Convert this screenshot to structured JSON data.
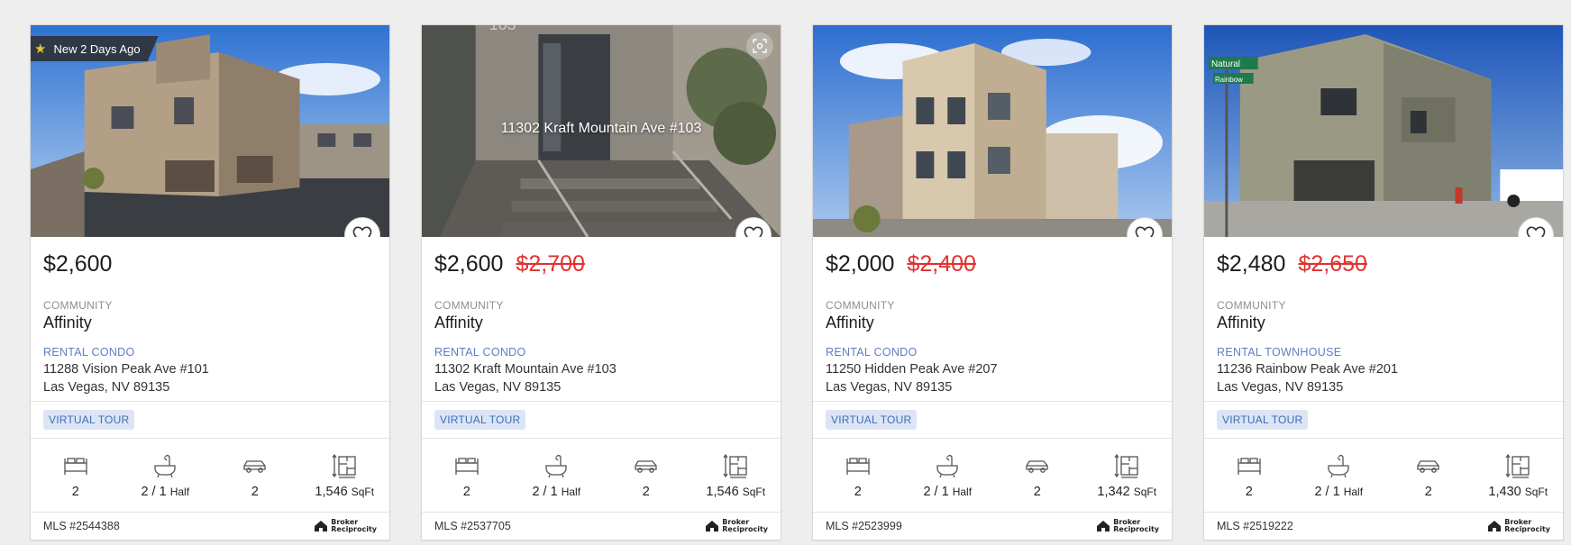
{
  "cards": [
    {
      "badge": "New 2 Days Ago",
      "photo_caption": "",
      "price": "$2,600",
      "old_price": "",
      "community_label": "COMMUNITY",
      "community": "Affinity",
      "property_type": "RENTAL CONDO",
      "address_line1": "11288 Vision Peak Ave #101",
      "address_line2": "Las Vegas, NV 89135",
      "virtual_tour": "VIRTUAL TOUR",
      "beds": "2",
      "baths": "2 / 1",
      "baths_unit": "Half",
      "garage": "2",
      "sqft": "1,546",
      "sqft_unit": "SqFt",
      "mls": "MLS #2544388"
    },
    {
      "badge": "",
      "photo_caption": "11302 Kraft Mountain Ave #103",
      "price": "$2,600",
      "old_price": "$2,700",
      "community_label": "COMMUNITY",
      "community": "Affinity",
      "property_type": "RENTAL CONDO",
      "address_line1": "11302 Kraft Mountain Ave #103",
      "address_line2": "Las Vegas, NV 89135",
      "virtual_tour": "VIRTUAL TOUR",
      "beds": "2",
      "baths": "2 / 1",
      "baths_unit": "Half",
      "garage": "2",
      "sqft": "1,546",
      "sqft_unit": "SqFt",
      "mls": "MLS #2537705"
    },
    {
      "badge": "",
      "photo_caption": "",
      "price": "$2,000",
      "old_price": "$2,400",
      "community_label": "COMMUNITY",
      "community": "Affinity",
      "property_type": "RENTAL CONDO",
      "address_line1": "11250 Hidden Peak Ave #207",
      "address_line2": "Las Vegas, NV 89135",
      "virtual_tour": "VIRTUAL TOUR",
      "beds": "2",
      "baths": "2 / 1",
      "baths_unit": "Half",
      "garage": "2",
      "sqft": "1,342",
      "sqft_unit": "SqFt",
      "mls": "MLS #2523999"
    },
    {
      "badge": "",
      "photo_caption": "",
      "price": "$2,480",
      "old_price": "$2,650",
      "community_label": "COMMUNITY",
      "community": "Affinity",
      "property_type": "RENTAL TOWNHOUSE",
      "address_line1": "11236 Rainbow Peak Ave #201",
      "address_line2": "Las Vegas, NV 89135",
      "virtual_tour": "VIRTUAL TOUR",
      "beds": "2",
      "baths": "2 / 1",
      "baths_unit": "Half",
      "garage": "2",
      "sqft": "1,430",
      "sqft_unit": "SqFt",
      "mls": "MLS #2519222"
    }
  ],
  "broker_logo": {
    "line1": "Broker",
    "line2": "Reciprocity"
  },
  "street_sign": {
    "line1": "Natural",
    "line2": "Rainbow"
  },
  "photo_ghost_text": "103",
  "icons": {
    "badge": "star-icon",
    "favorite": "heart-icon",
    "scan": "scan-icon",
    "beds": "bed-icon",
    "baths": "bathtub-icon",
    "garage": "car-icon",
    "sqft": "floorplan-icon",
    "broker": "house-logo-icon"
  },
  "colors": {
    "old_price": "#e0322f",
    "property_type": "#5f7fc0",
    "tag_bg": "#dbe5f5",
    "tag_text": "#3f6fb5",
    "badge_bg": "#2f3845",
    "badge_star": "#e6c229"
  }
}
